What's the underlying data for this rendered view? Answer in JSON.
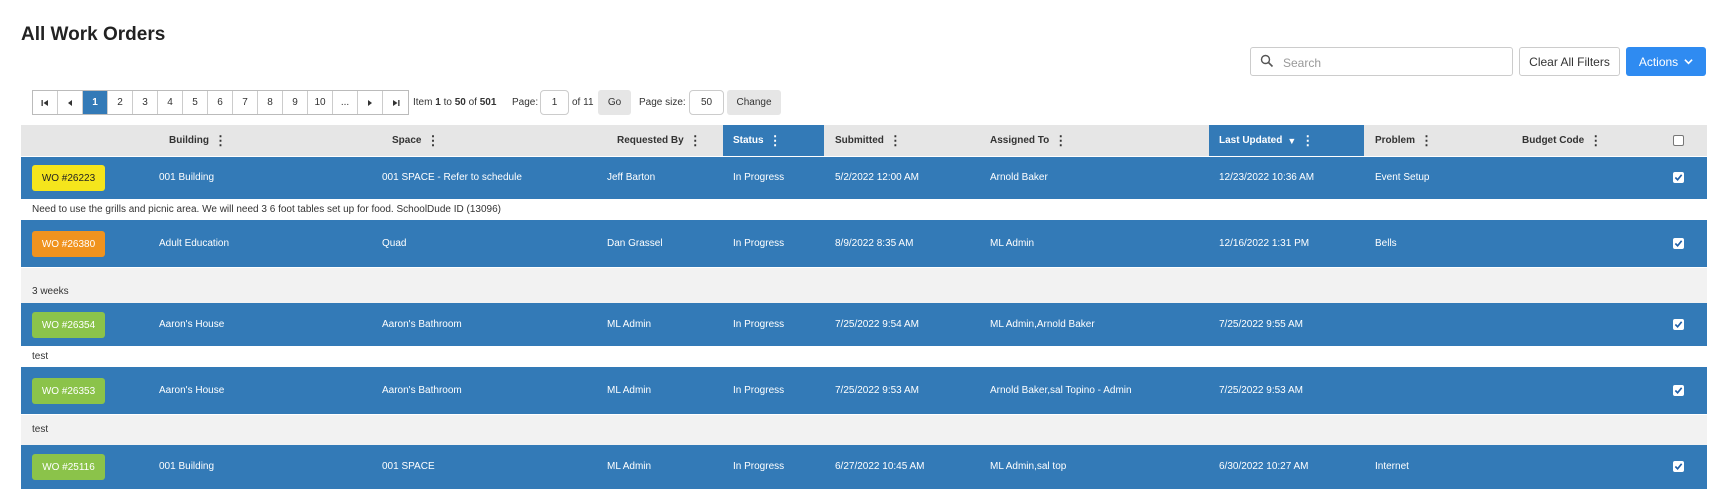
{
  "page": {
    "title": "All Work Orders"
  },
  "toolbar": {
    "search_placeholder": "Search",
    "search_value": "",
    "clear_label": "Clear All Filters",
    "actions_label": "Actions"
  },
  "pager": {
    "pages": [
      "1",
      "2",
      "3",
      "4",
      "5",
      "6",
      "7",
      "8",
      "9",
      "10",
      "..."
    ],
    "current": "1",
    "item_prefix": "Item",
    "item_from": "1",
    "item_to_word": "to",
    "item_to": "50",
    "item_of_word": "of",
    "item_total": "501",
    "page_label": "Page:",
    "page_value": "1",
    "page_of": "of 11",
    "go_label": "Go",
    "size_label": "Page size:",
    "size_value": "50",
    "change_label": "Change"
  },
  "columns": {
    "building": "Building",
    "space": "Space",
    "requested_by": "Requested By",
    "status": "Status",
    "submitted": "Submitted",
    "assigned_to": "Assigned To",
    "last_updated": "Last Updated",
    "problem": "Problem",
    "budget_code": "Budget Code"
  },
  "colors": {
    "header_bg": "#e6e6e6",
    "row_bg": "#337ab7",
    "accent": "#2f8bf1",
    "badge_yellow": "#f5e51c",
    "badge_orange": "#f0931f",
    "badge_green": "#8bc34a"
  },
  "rows": [
    {
      "wo": "WO #26223",
      "badge_color": "#f5e51c",
      "badge_text_color": "#222",
      "building": "001 Building",
      "space": "001 SPACE - Refer to schedule",
      "requested_by": "Jeff Barton",
      "status": "In Progress",
      "submitted": "5/2/2022 12:00 AM",
      "assigned_to": "Arnold Baker",
      "last_updated": "12/23/2022 10:36 AM",
      "problem": "Event Setup",
      "budget_code": "",
      "checked": true,
      "description": "Need to use the grills and picnic area. We will need 3 6 foot tables set up for food. SchoolDude ID (13096)"
    },
    {
      "wo": "WO #26380",
      "badge_color": "#f0931f",
      "badge_text_color": "#fff",
      "building": "Adult Education",
      "space": "Quad",
      "requested_by": "Dan Grassel",
      "status": "In Progress",
      "submitted": "8/9/2022 8:35 AM",
      "assigned_to": "ML Admin",
      "last_updated": "12/16/2022 1:31 PM",
      "problem": "Bells",
      "budget_code": "",
      "checked": true,
      "description": "3 weeks"
    },
    {
      "wo": "WO #26354",
      "badge_color": "#8bc34a",
      "badge_text_color": "#fff",
      "building": "Aaron's House",
      "space": "Aaron's Bathroom",
      "requested_by": "ML Admin",
      "status": "In Progress",
      "submitted": "7/25/2022 9:54 AM",
      "assigned_to": "ML Admin,Arnold Baker",
      "last_updated": "7/25/2022 9:55 AM",
      "problem": "",
      "budget_code": "",
      "checked": true,
      "description": "test"
    },
    {
      "wo": "WO #26353",
      "badge_color": "#8bc34a",
      "badge_text_color": "#fff",
      "building": "Aaron's House",
      "space": "Aaron's Bathroom",
      "requested_by": "ML Admin",
      "status": "In Progress",
      "submitted": "7/25/2022 9:53 AM",
      "assigned_to": "Arnold Baker,sal Topino - Admin",
      "last_updated": "7/25/2022 9:53 AM",
      "problem": "",
      "budget_code": "",
      "checked": true,
      "description": "test"
    },
    {
      "wo": "WO #25116",
      "badge_color": "#8bc34a",
      "badge_text_color": "#fff",
      "building": "001 Building",
      "space": "001 SPACE",
      "requested_by": "ML Admin",
      "status": "In Progress",
      "submitted": "6/27/2022 10:45 AM",
      "assigned_to": "ML Admin,sal top",
      "last_updated": "6/30/2022 10:27 AM",
      "problem": "Internet",
      "budget_code": "",
      "checked": true,
      "description": ""
    }
  ]
}
